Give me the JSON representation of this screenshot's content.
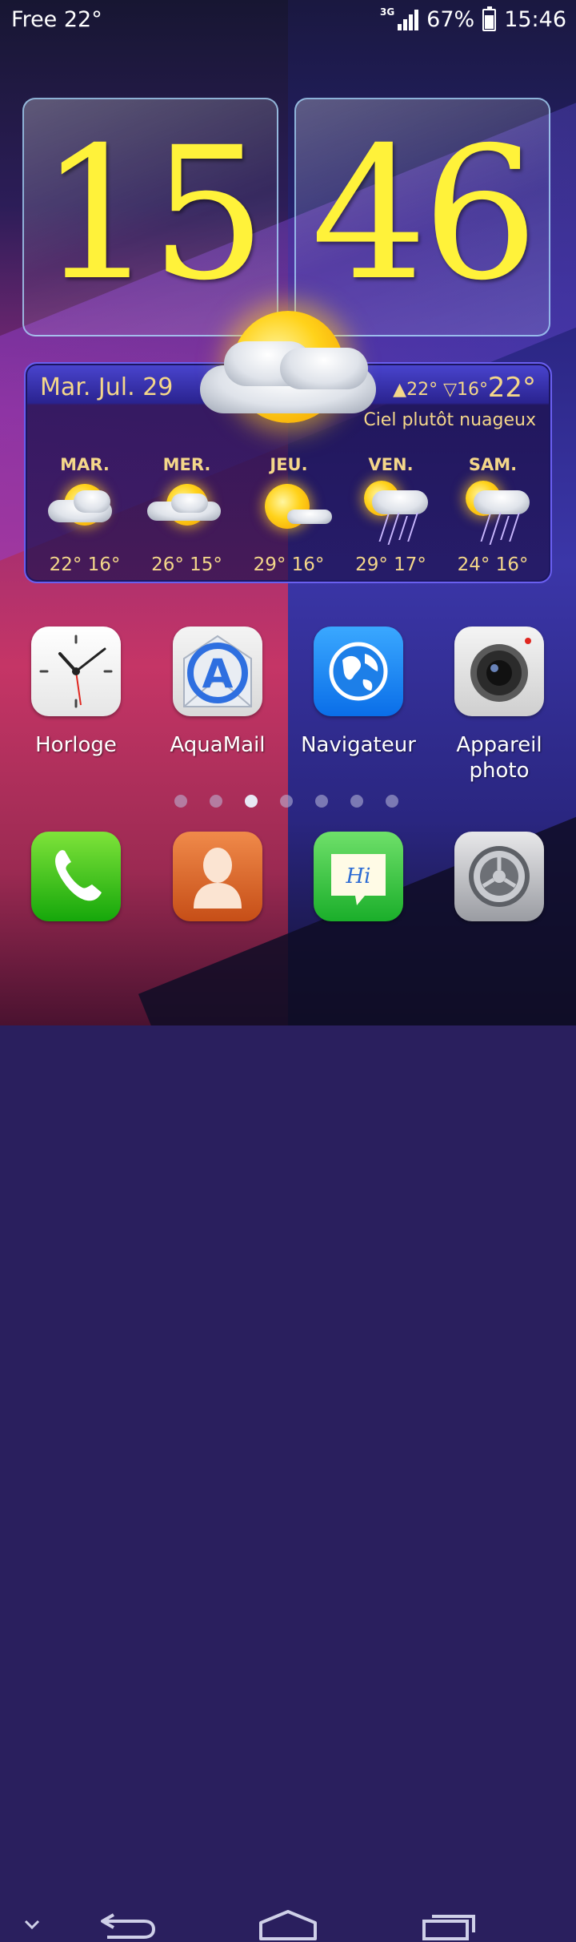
{
  "status_bar": {
    "carrier": "Free 22°",
    "network": "3G",
    "battery": "67%",
    "battery_level": 0.67,
    "time": "15:46"
  },
  "clock_widget": {
    "hours": "15",
    "minutes": "46"
  },
  "weather": {
    "date": "Mar. Jul. 29",
    "high": "▲22°",
    "low": "▽16°",
    "current": "22°",
    "condition": "Ciel plutôt nuageux",
    "forecast": [
      {
        "day": "MAR.",
        "temps": "22° 16°",
        "icon": "partly-cloudy"
      },
      {
        "day": "MER.",
        "temps": "26° 15°",
        "icon": "partly-cloudy"
      },
      {
        "day": "JEU.",
        "temps": "29° 16°",
        "icon": "mostly-sunny"
      },
      {
        "day": "VEN.",
        "temps": "29° 17°",
        "icon": "thunderstorm"
      },
      {
        "day": "SAM.",
        "temps": "24° 16°",
        "icon": "thunderstorm"
      }
    ]
  },
  "apps": [
    {
      "label": "Horloge",
      "icon": "clock-icon"
    },
    {
      "label": "AquaMail",
      "icon": "aquamail-icon"
    },
    {
      "label": "Navigateur",
      "icon": "globe-icon"
    },
    {
      "label": "Appareil photo",
      "icon": "camera-icon"
    }
  ],
  "page_indicator": {
    "count": 7,
    "active": 3
  },
  "dock": [
    {
      "icon": "phone-icon"
    },
    {
      "icon": "contacts-icon"
    },
    {
      "icon": "messages-icon",
      "text": "Hi"
    },
    {
      "icon": "settings-icon"
    }
  ],
  "nav": [
    "chevron-down-icon",
    "back-icon",
    "home-icon",
    "recents-icon"
  ]
}
